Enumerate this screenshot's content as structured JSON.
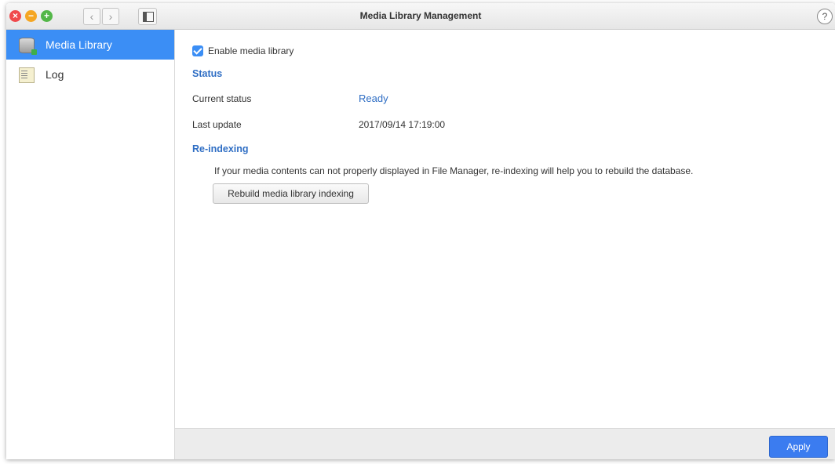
{
  "window": {
    "title": "Media Library Management",
    "help_label": "?",
    "nav_back": "‹",
    "nav_forward": "›"
  },
  "sidebar": {
    "items": [
      {
        "label": "Media Library",
        "icon": "database-icon",
        "active": true
      },
      {
        "label": "Log",
        "icon": "log-icon",
        "active": false
      }
    ]
  },
  "main": {
    "enable_label": "Enable media library",
    "enable_checked": true,
    "status_heading": "Status",
    "current_status_label": "Current status",
    "current_status_value": "Ready",
    "last_update_label": "Last update",
    "last_update_value": "2017/09/14 17:19:00",
    "reindex_heading": "Re-indexing",
    "reindex_description": "If your media contents can not properly displayed in File Manager, re-indexing will help you to rebuild the database.",
    "rebuild_button": "Rebuild media library indexing"
  },
  "footer": {
    "apply_button": "Apply"
  },
  "colors": {
    "accent": "#3b8ef5",
    "heading": "#2f6ec4",
    "close": "#f0494c",
    "minimize": "#f5a623",
    "maximize": "#53b748"
  }
}
